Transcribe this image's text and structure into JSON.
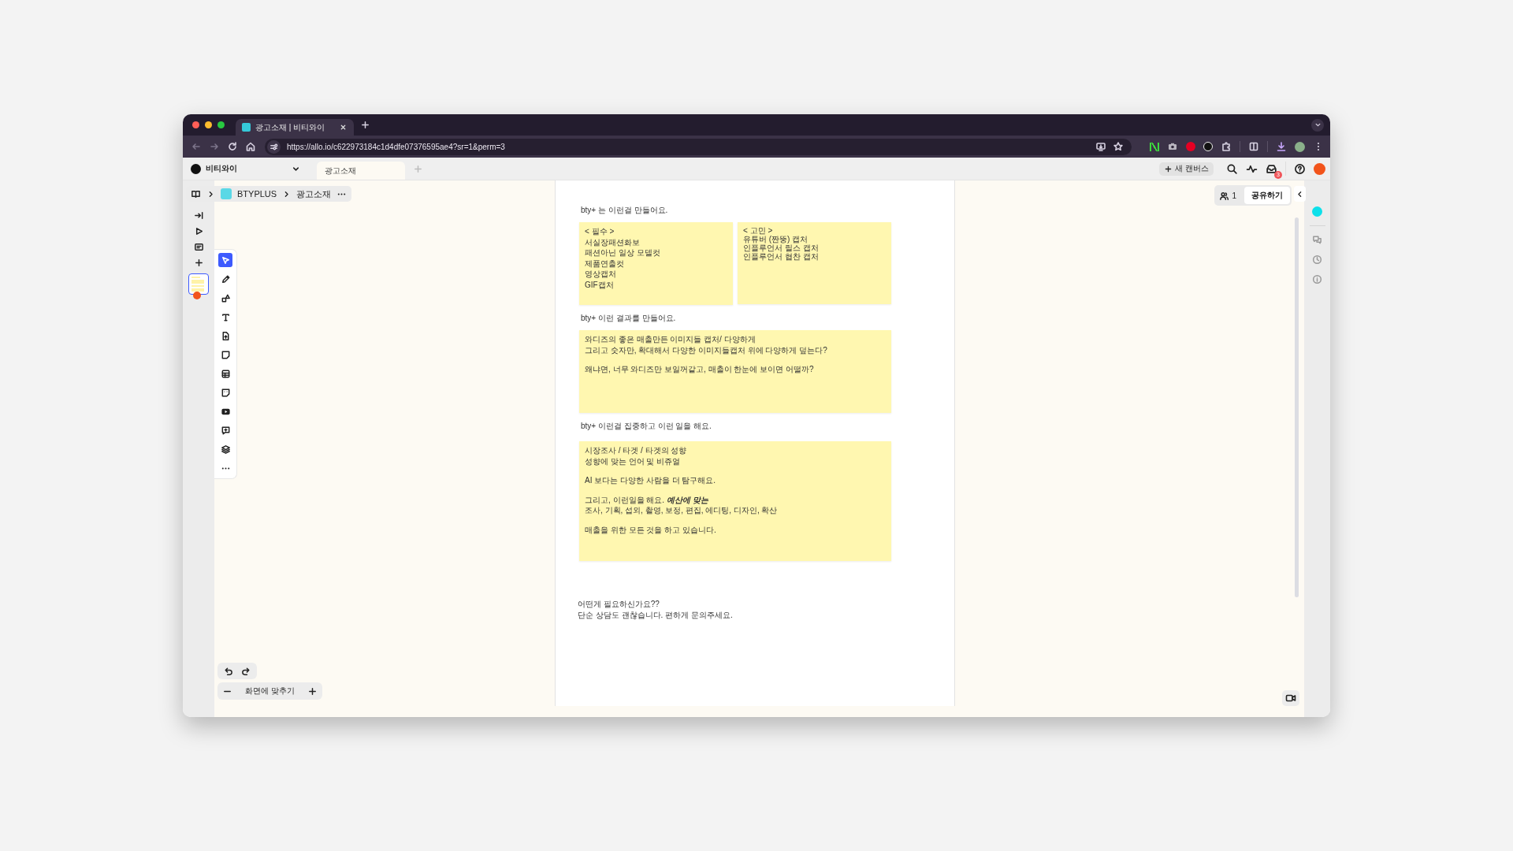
{
  "browser": {
    "tab_title": "광고소재 | 비티와이",
    "url": "https://allo.io/c622973184c1d4dfe07376595ae4?sr=1&perm=3"
  },
  "app_bar": {
    "workspace": "비티와이",
    "tabs": [
      {
        "label": "광고소재",
        "selected": true
      }
    ],
    "new_canvas": "새 캔버스",
    "inbox_badge": "3"
  },
  "breadcrumb": [
    "BTYPLUS",
    "광고소재"
  ],
  "tools": [
    {
      "kind": "select",
      "selected": true
    },
    {
      "kind": "pen",
      "selected": false
    },
    {
      "kind": "shapes",
      "selected": false
    },
    {
      "kind": "text",
      "selected": false
    },
    {
      "kind": "upload",
      "selected": false
    },
    {
      "kind": "sticky",
      "selected": false
    },
    {
      "kind": "table",
      "selected": false
    },
    {
      "kind": "sticker",
      "selected": false
    },
    {
      "kind": "video",
      "selected": false
    },
    {
      "kind": "comment",
      "selected": false
    },
    {
      "kind": "layers",
      "selected": false
    },
    {
      "kind": "more",
      "selected": false
    }
  ],
  "zoom_label": "화면에 맞추기",
  "share": {
    "people_count": "1",
    "button": "공유하기"
  },
  "document": {
    "blocks": [
      {
        "kind": "heading",
        "text": "bty+ 는 이런걸 만들어요."
      },
      {
        "kind": "notes",
        "notes": [
          {
            "kind": "normal",
            "paragraphs": [
              [
                {
                  "text": "< 필수 >"
                },
                {
                  "text": "서실장패션화보"
                },
                {
                  "text": "패션아닌 일상 모델컷"
                },
                {
                  "text": "제품연출컷"
                },
                {
                  "text": "영상캡처"
                },
                {
                  "text": "GIF캡처"
                }
              ]
            ]
          },
          {
            "kind": "small",
            "paragraphs": [
              [
                {
                  "text": "< 고민 >"
                },
                {
                  "text": "유튜버 (짠뚱) 캡처"
                },
                {
                  "text": "인플루언서 릴스 캡처"
                },
                {
                  "text": "인플루언서 협찬 캡처"
                }
              ]
            ]
          }
        ]
      },
      {
        "kind": "heading",
        "text": "bty+ 이런 결과를 만들어요."
      },
      {
        "kind": "notes",
        "notes": [
          {
            "kind": "normal",
            "paragraphs": [
              [
                {
                  "text": "와디즈의 좋은 매출만든 이미지들 캡처/ 다양하게"
                },
                {
                  "text": "그리고 숫자만, 확대해서 다양한 이미지들캡처 위에 다양하게 덮는다?"
                }
              ],
              [
                {
                  "text": "왜냐면, 너무 와디즈만 보일꺼같고, 매출이 한눈에 보이면 어떨까?"
                }
              ]
            ]
          }
        ]
      },
      {
        "kind": "heading",
        "text": "bty+ 이런걸 집중하고 이런 일을 해요."
      },
      {
        "kind": "notes",
        "notes": [
          {
            "kind": "tall",
            "paragraphs": [
              [
                {
                  "text": "시장조사 / 타겟 / 타겟의 성향"
                },
                {
                  "text": "성향에 맞는 언어 및 비쥬얼"
                }
              ],
              [
                {
                  "text": "AI 보다는 다양한 사람을 더 탐구해요."
                }
              ],
              [
                {
                  "text": "그리고, 이런일을 해요. ",
                  "emphasis": "예산에 맞는"
                },
                {
                  "text": "조사, 기획, 섭외, 촬영, 보정, 편집, 에디팅, 디자인, 확산"
                }
              ],
              [
                {
                  "text": "매출을 위한 모든 것을 하고 있습니다."
                }
              ]
            ]
          }
        ]
      },
      {
        "kind": "closing",
        "lines": [
          "어떤게 필요하신가요??",
          "단순 상담도 괜찮습니다. 편하게 문의주세요."
        ]
      }
    ]
  }
}
